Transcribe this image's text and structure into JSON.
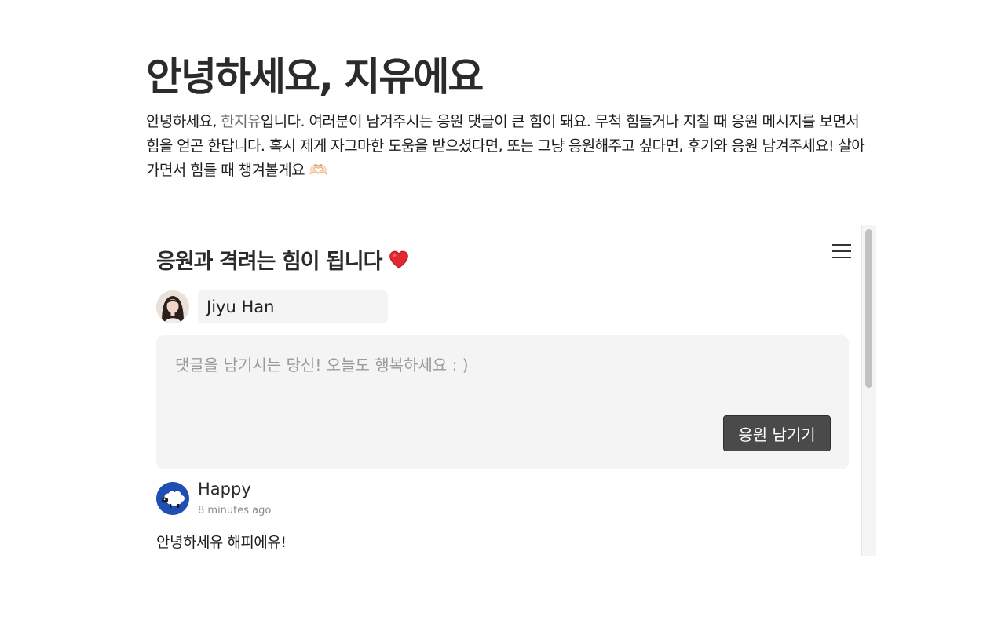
{
  "header": {
    "title": "안녕하세요, 지유에요",
    "intro_before": "안녕하세요, ",
    "intro_link": "한지유",
    "intro_after": "입니다. 여러분이 남겨주시는 응원 댓글이 큰 힘이 돼요. 무척 힘들거나 지칠 때 응원 메시지를 보면서 힘을 얻곤 한답니다. 혹시 제게 자그마한 도움을 받으셨다면, 또는 그냥 응원해주고 싶다면, 후기와 응원 남겨주세요! 살아가면서 힘들 때 챙겨볼게요",
    "intro_emoji": "🫶🏻"
  },
  "widget": {
    "title": "응원과 격려는 힘이 됩니다",
    "title_icon": "heart-icon",
    "menu_icon": "hamburger-menu-icon",
    "user": {
      "name_value": "Jiyu Han",
      "avatar": "user-avatar-photo"
    },
    "comment": {
      "placeholder": "댓글을 남기시는 당신! 오늘도 행복하세요 : )",
      "value": "",
      "submit_label": "응원 남기기"
    },
    "comments": [
      {
        "author": "Happy",
        "time": "8 minutes ago",
        "body": "안녕하세유 해피에유!",
        "avatar": "sheep-avatar-icon"
      }
    ]
  },
  "colors": {
    "accent_button": "#4a4a4a",
    "input_bg": "#f4f4f4",
    "heart": "#e0282e",
    "happy_avatar_bg": "#1f4fb5"
  }
}
